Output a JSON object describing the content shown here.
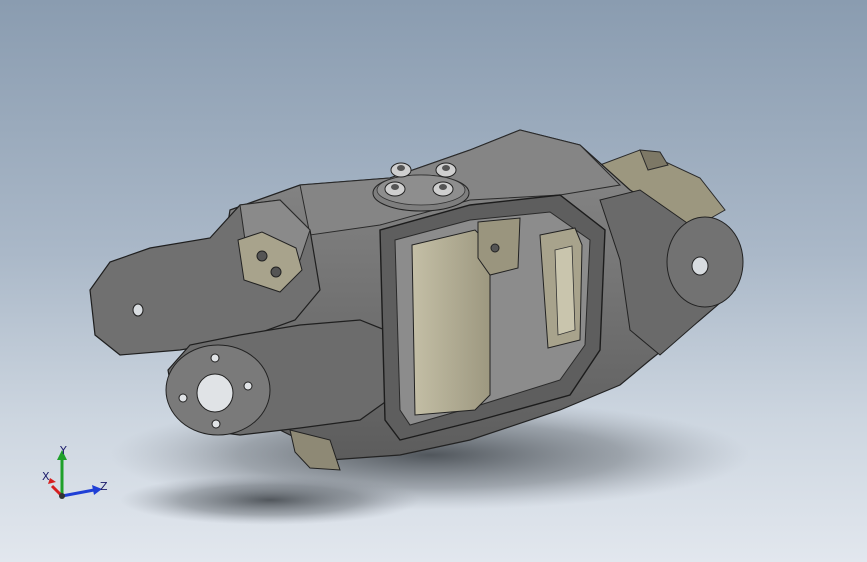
{
  "viewport": {
    "triad": {
      "x_label": "X",
      "y_label": "Y",
      "z_label": "Z",
      "x_color": "#d62020",
      "y_color": "#1fa02a",
      "z_color": "#1f3fd6"
    },
    "model": {
      "body_color": "#6f6f6f",
      "dark_color": "#4a4a4a",
      "light_color": "#8c8c8c",
      "insert_color": "#b7b29a",
      "screw_color": "#c8c8c8"
    }
  }
}
